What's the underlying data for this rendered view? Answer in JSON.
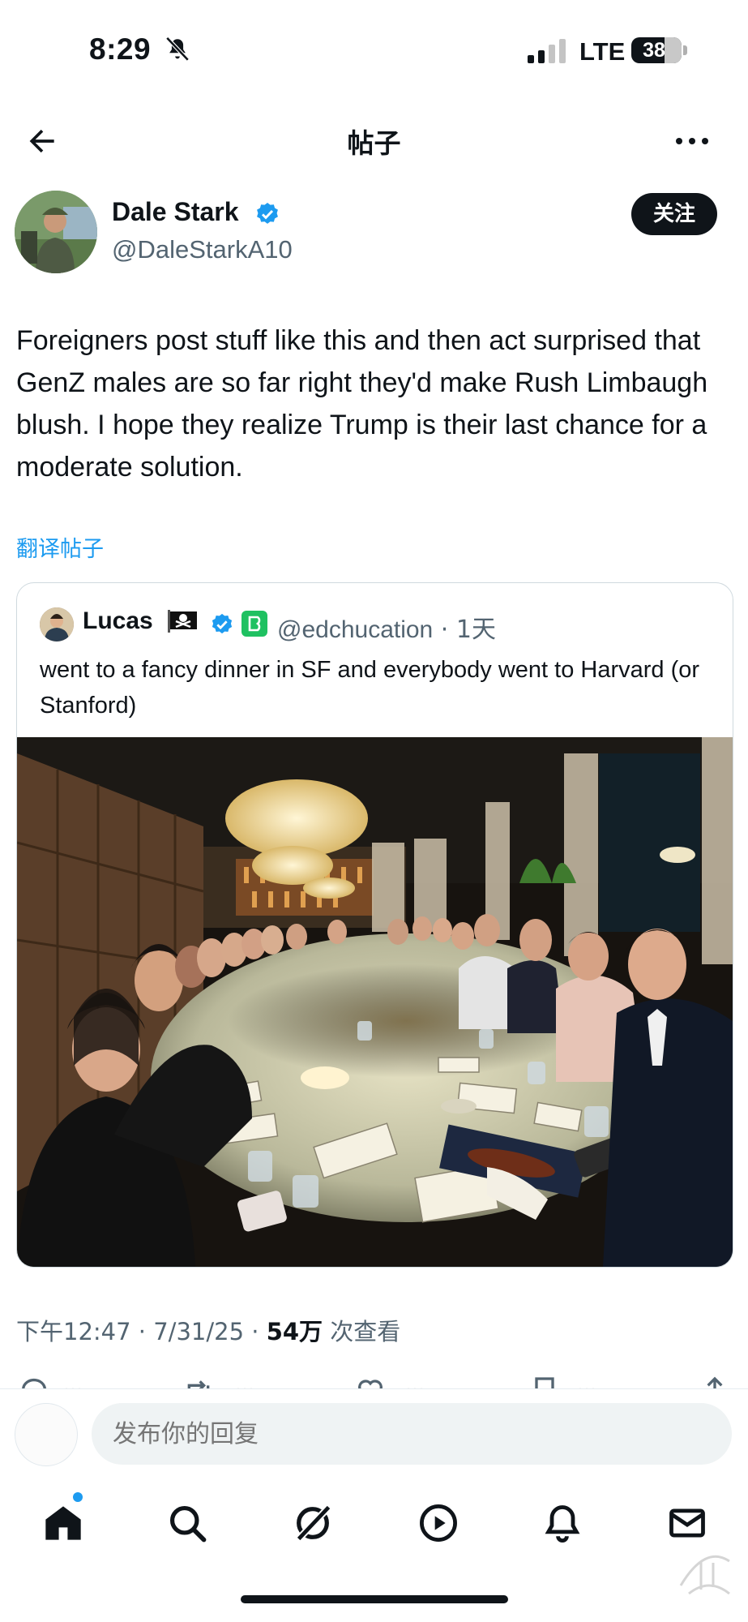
{
  "status_bar": {
    "time": "8:29",
    "network": "LTE",
    "battery": "38"
  },
  "header": {
    "title": "帖子"
  },
  "tweet": {
    "author_name": "Dale Stark",
    "author_handle": "@DaleStarkA10",
    "follow_label": "关注",
    "text": "Foreigners post stuff like this and then act surprised that GenZ males are so far right they'd make Rush Limbaugh blush.  I hope they realize Trump is their last chance for a moderate solution.",
    "translate_label": "翻译帖子",
    "meta_time": "下午12:47 · 7/31/25 · ",
    "meta_views": "54万",
    "meta_views_label": " 次查看"
  },
  "quoted_tweet": {
    "author_name": "Lucas",
    "author_handle": "@edchucation",
    "age": " · 1天",
    "text": "went to a fancy dinner in SF and everybody went to Harvard (or Stanford)"
  },
  "reply": {
    "placeholder": "发布你的回复"
  },
  "tabbar": {
    "items": [
      "home-icon",
      "search-icon",
      "grok-icon",
      "video-icon",
      "bell-icon",
      "mail-icon"
    ]
  },
  "colors": {
    "accent": "#1d9bf0",
    "text": "#0f1419",
    "muted": "#536471"
  }
}
